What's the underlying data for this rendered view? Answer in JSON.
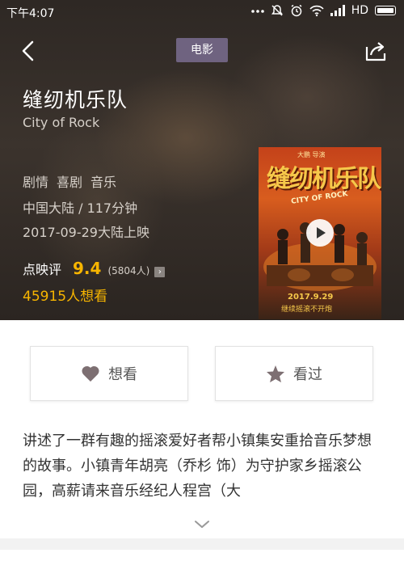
{
  "status_bar": {
    "time": "下午4:07",
    "network": "HD",
    "icons": [
      "dots-icon",
      "mute-icon",
      "alarm-icon",
      "wifi-icon",
      "signal-icon",
      "battery-icon"
    ]
  },
  "header": {
    "category": "电影"
  },
  "movie": {
    "title_cn": "缝纫机乐队",
    "title_en": "City of Rock",
    "genres": [
      "剧情",
      "喜剧",
      "音乐"
    ],
    "origin_duration": "中国大陆 / 117分钟",
    "release": "2017-09-29大陆上映",
    "rating_label": "点映评",
    "rating_score": "9.4",
    "rating_count": "(5804人)",
    "want_count": "45915人想看"
  },
  "poster": {
    "title": "缝纫机乐队",
    "subtitle": "CITY OF ROCK",
    "top_text": "大鹏 导演",
    "date": "2017.9.29",
    "date_sub": "继续摇滚不开炮"
  },
  "actions": {
    "want_label": "想看",
    "seen_label": "看过"
  },
  "synopsis": {
    "text": "讲述了一群有趣的摇滚爱好者帮小镇集安重拾音乐梦想的故事。小镇青年胡亮（乔杉 饰）为守护家乡摇滚公园，高薪请来音乐经纪人程宫（大"
  },
  "colors": {
    "accent": "#f7b500",
    "tag_bg": "#6f6380",
    "hero_bg": "#332c27"
  }
}
